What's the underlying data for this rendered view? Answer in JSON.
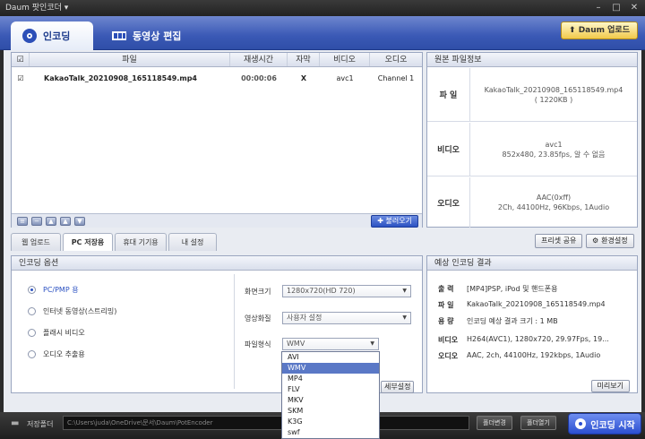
{
  "window": {
    "title": "Daum 팟인코더 ▾"
  },
  "tabs": [
    {
      "label": "인코딩",
      "icon": "disc-icon"
    },
    {
      "label": "동영상 편집",
      "icon": "film-icon"
    }
  ],
  "header": {
    "daum_upload": "Daum 업로드"
  },
  "file_table": {
    "columns": [
      "",
      "파일",
      "재생시간",
      "자막",
      "비디오",
      "오디오"
    ],
    "rows": [
      {
        "checked": true,
        "file": "KakaoTalk_20210908_165118549.mp4",
        "duration": "00:00:06",
        "subtitle": "X",
        "video": "avc1",
        "audio": "Channel 1"
      }
    ],
    "load_button": "불러오기"
  },
  "source_info": {
    "title": "원본 파일정보",
    "rows": [
      {
        "label": "파 일",
        "lines": [
          "KakaoTalk_20210908_165118549.mp4",
          "( 1220KB )"
        ]
      },
      {
        "label": "비디오",
        "lines": [
          "avc1",
          "852x480, 23.85fps, 알 수 없음"
        ]
      },
      {
        "label": "오디오",
        "lines": [
          "AAC(0xff)",
          "2Ch, 44100Hz, 96Kbps, 1Audio"
        ]
      }
    ]
  },
  "sub_tabs": [
    "웹 업로드용",
    "PC 저장용",
    "휴대 기기용",
    "내 설정"
  ],
  "active_sub_tab": 1,
  "share_preset": "프리셋 공유",
  "env_settings": "환경설정",
  "encoding_options": {
    "title": "인코딩 옵션",
    "radios": [
      "PC/PMP 용",
      "인터넷 동영상(스트리밍)",
      "플래시 비디오",
      "오디오 추출용"
    ],
    "selected": 0,
    "size_label": "화면크기",
    "size_value": "1280x720(HD 720)",
    "quality_label": "영상화질",
    "quality_value": "사용자 설정",
    "format_label": "파일형식",
    "format_value": "WMV",
    "detail_button": "세부설정",
    "format_options": [
      "AVI",
      "WMV",
      "MP4",
      "FLV",
      "MKV",
      "SKM",
      "K3G",
      "swf"
    ],
    "format_selected": 1
  },
  "result": {
    "title": "예상 인코딩 결과",
    "rows": [
      {
        "label": "출 력",
        "value": "[MP4]PSP, iPod 및 핸드폰용"
      },
      {
        "label": "파 일",
        "value": "KakaoTalk_20210908_165118549.mp4"
      },
      {
        "label": "용 량",
        "value": "인코딩 예상 결과 크기 : 1 MB"
      },
      {
        "label": "비디오",
        "value": "H264(AVC1), 1280x720, 29.97Fps, 19..."
      },
      {
        "label": "오디오",
        "value": "AAC, 2ch, 44100Hz, 192kbps, 1Audio"
      }
    ],
    "preview_button": "미리보기"
  },
  "bottom": {
    "save_label": "저장폴더",
    "path": "C:\\Users\\juda\\OneDrive\\문서\\Daum\\PotEncoder",
    "change_folder": "폴더변경",
    "open_folder": "폴더열기",
    "start": "인코딩 시작"
  }
}
